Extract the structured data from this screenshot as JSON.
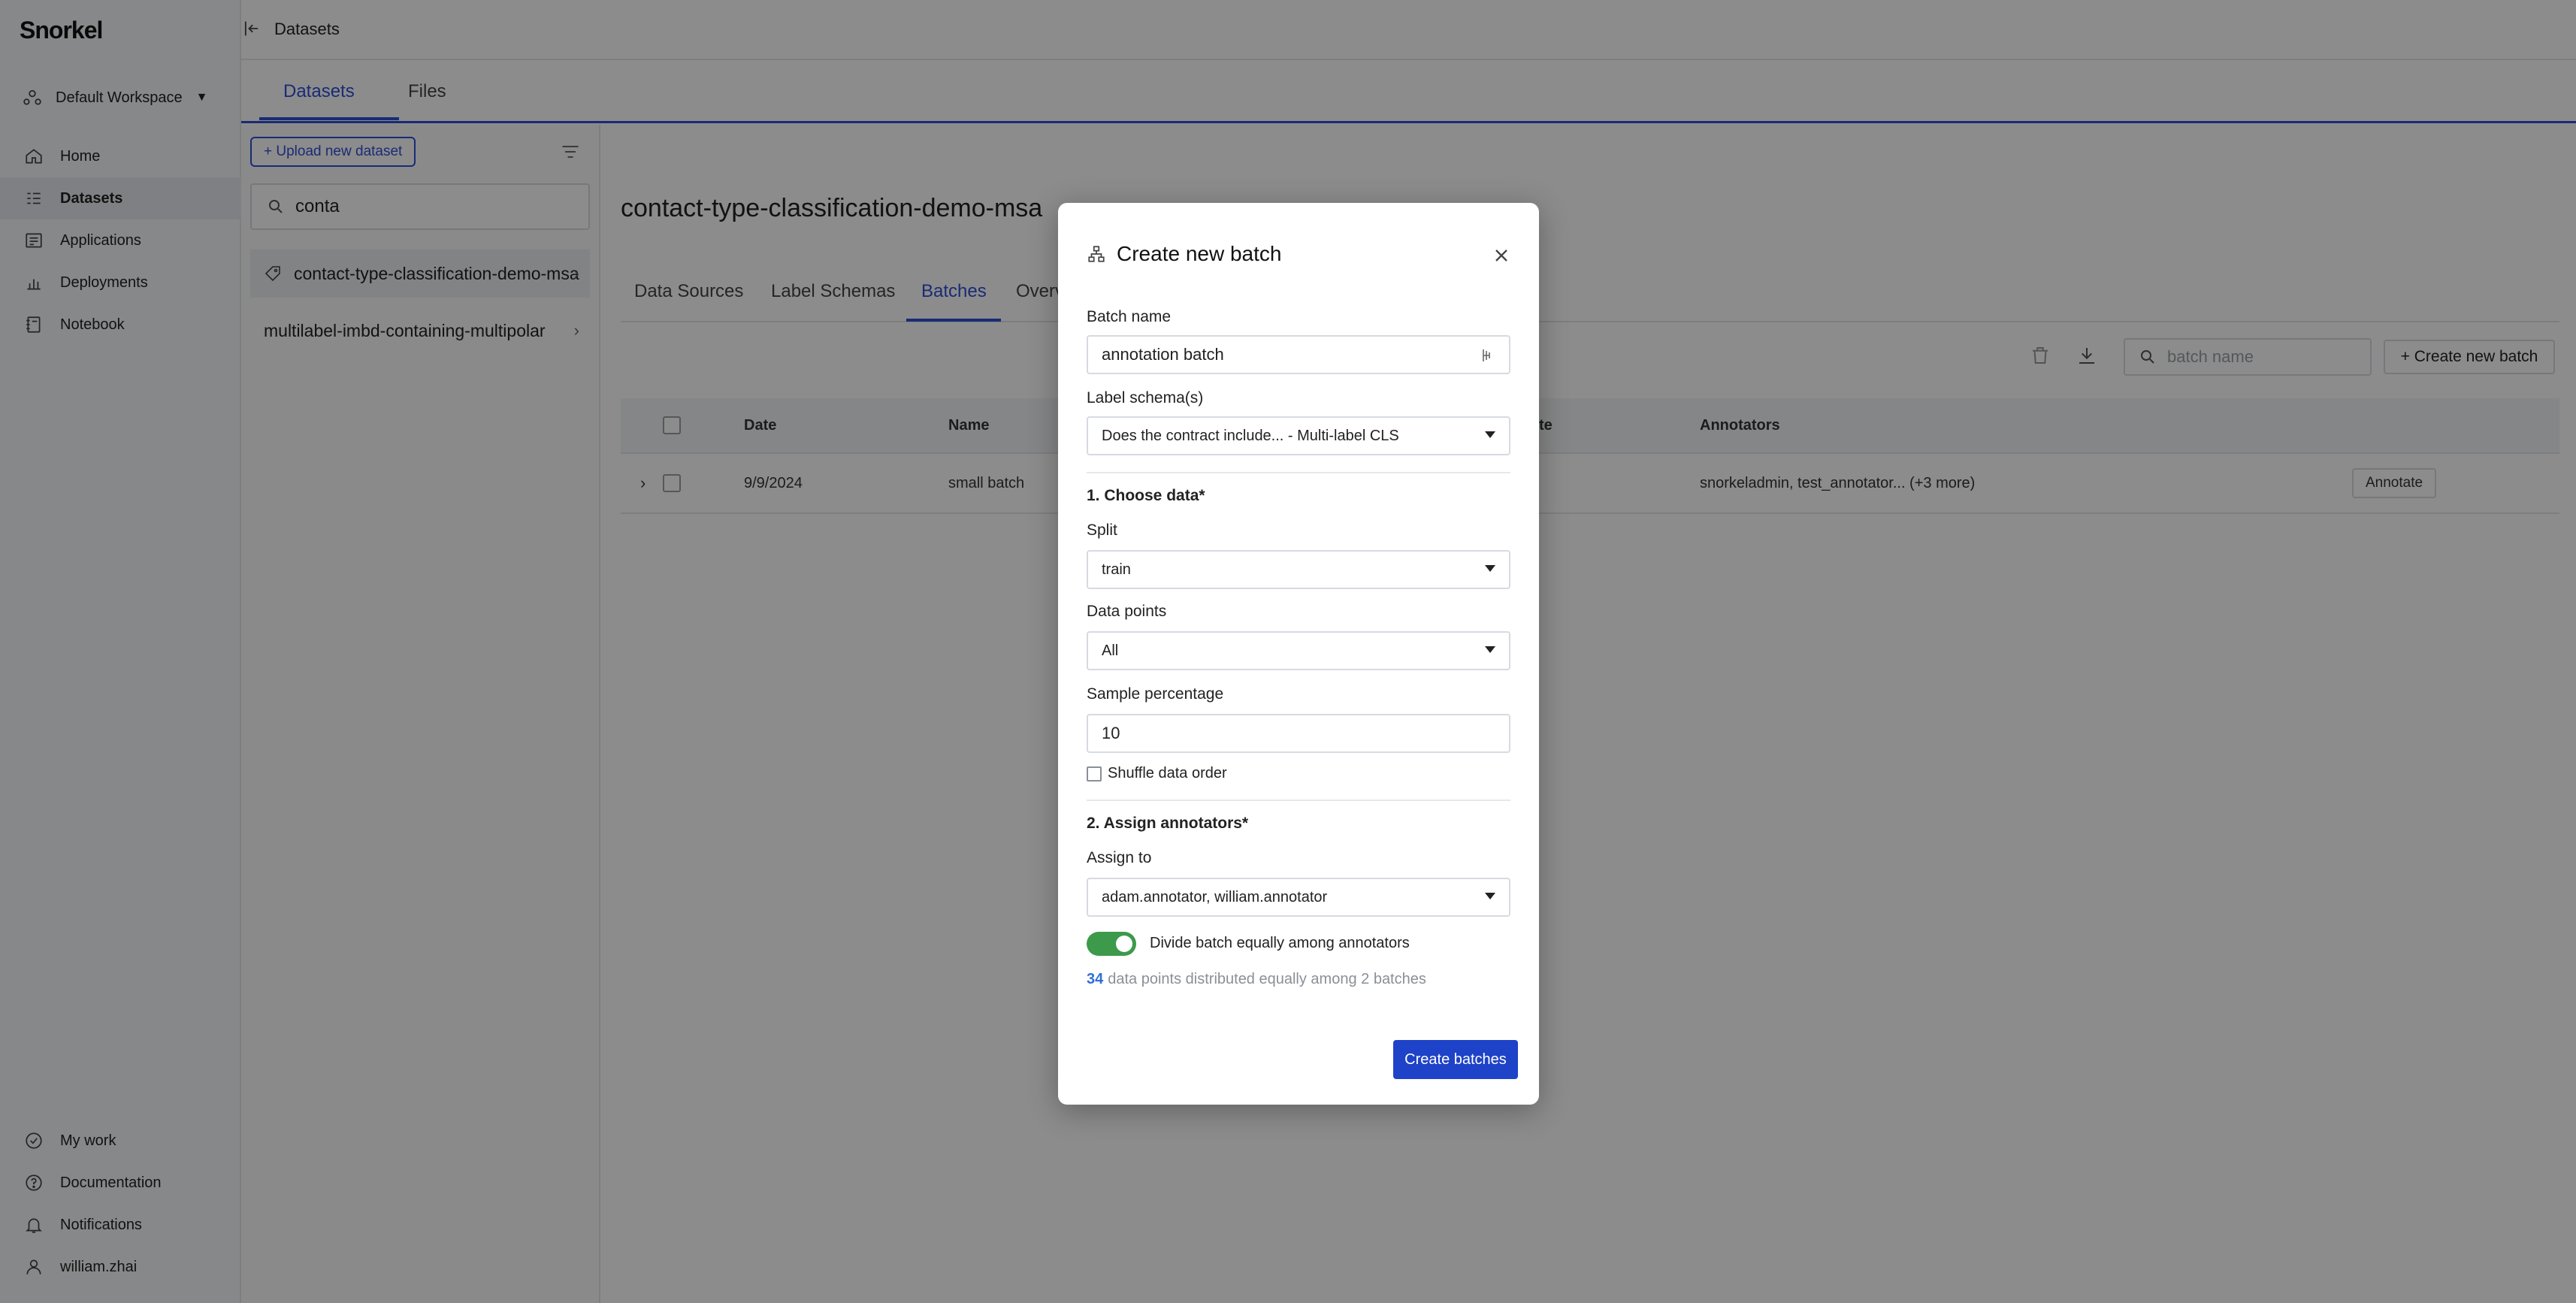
{
  "app": {
    "logo": "Snorkel"
  },
  "sidebar": {
    "workspace": "Default Workspace",
    "nav": [
      {
        "label": "Home",
        "icon": "home-icon"
      },
      {
        "label": "Datasets",
        "icon": "datasets-icon",
        "active": true
      },
      {
        "label": "Applications",
        "icon": "applications-icon"
      },
      {
        "label": "Deployments",
        "icon": "deployments-icon"
      },
      {
        "label": "Notebook",
        "icon": "notebook-icon"
      }
    ],
    "bottom": [
      {
        "label": "My work",
        "icon": "check-circle-icon"
      },
      {
        "label": "Documentation",
        "icon": "help-icon"
      },
      {
        "label": "Notifications",
        "icon": "bell-icon"
      },
      {
        "label": "william.zhai",
        "icon": "user-icon"
      }
    ]
  },
  "header": {
    "breadcrumb": "Datasets",
    "tabs": [
      "Datasets",
      "Files"
    ]
  },
  "dataset_list": {
    "upload_label": "+ Upload new dataset",
    "search_value": "conta",
    "items": [
      "contact-type-classification-demo-msa",
      "multilabel-imbd-containing-multipolar"
    ]
  },
  "main": {
    "title": "contact-type-classification-demo-msa",
    "subtabs": [
      "Data Sources",
      "Label Schemas",
      "Batches",
      "Overview"
    ],
    "batch_search_placeholder": "batch name",
    "create_batch_label": "+ Create new batch",
    "table": {
      "headers": [
        "Date",
        "Name",
        "Annotators"
      ],
      "partial_header": "te",
      "rows": [
        {
          "date": "9/9/2024",
          "name": "small batch",
          "annotators": "snorkeladmin, test_annotator... (+3 more)",
          "action": "Annotate"
        }
      ]
    }
  },
  "modal": {
    "title": "Create new batch",
    "batch_name_label": "Batch name",
    "batch_name_value": "annotation batch",
    "label_schema_label": "Label schema(s)",
    "label_schema_value": "Does the contract include... - Multi-label CLS",
    "section1": "1. Choose data*",
    "split_label": "Split",
    "split_value": "train",
    "data_points_label": "Data points",
    "data_points_value": "All",
    "sample_label": "Sample percentage",
    "sample_value": "10",
    "shuffle_label": "Shuffle data order",
    "section2": "2. Assign annotators*",
    "assign_label": "Assign to",
    "assign_value": "adam.annotator, william.annotator",
    "divide_label": "Divide batch equally among annotators",
    "divide_enabled": true,
    "dist_count": "34",
    "dist_text": "data points distributed equally among 2 batches",
    "submit_label": "Create batches"
  },
  "colors": {
    "accent": "#2f4fd6",
    "primary_button": "#1e42c8",
    "toggle_on": "#3c9a4a"
  }
}
